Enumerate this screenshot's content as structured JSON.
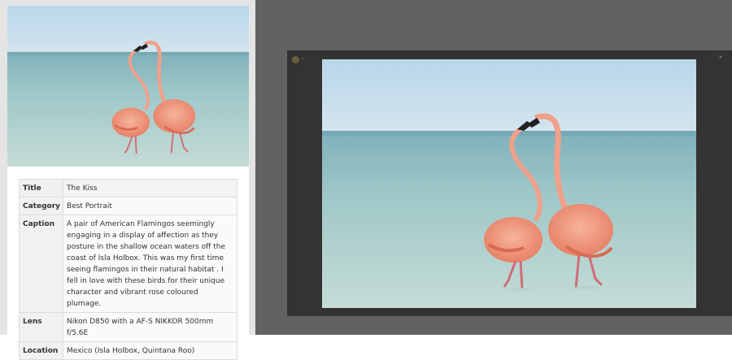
{
  "photo_info": {
    "rows": [
      {
        "label": "Title",
        "value": "The Kiss"
      },
      {
        "label": "Category",
        "value": "Best Portrait"
      },
      {
        "label": "Caption",
        "value": "A pair of American Flamingos seemingly engaging in a display of affection as they posture in the shallow ocean waters off the coast of Isla Holbox. This was my first time seeing flamingos in their natural habitat . I fell in love with these birds for their unique character and vibrant rose coloured plumage."
      },
      {
        "label": "Lens",
        "value": "Nikon D850 with a AF-S NIKKOR 500mm f/5.6E"
      },
      {
        "label": "Location",
        "value": "Mexico (Isla Holbox, Quintana Roo)"
      }
    ]
  },
  "lightbox": {
    "close_icon": "close-icon",
    "logo_icon": "site-logo-icon"
  },
  "colors": {
    "sky": "#c3dcea",
    "sea": "#9ac3c5",
    "flamingo": "#ee9a80",
    "overlay": "#626262",
    "lightbox_bg": "#333333"
  }
}
